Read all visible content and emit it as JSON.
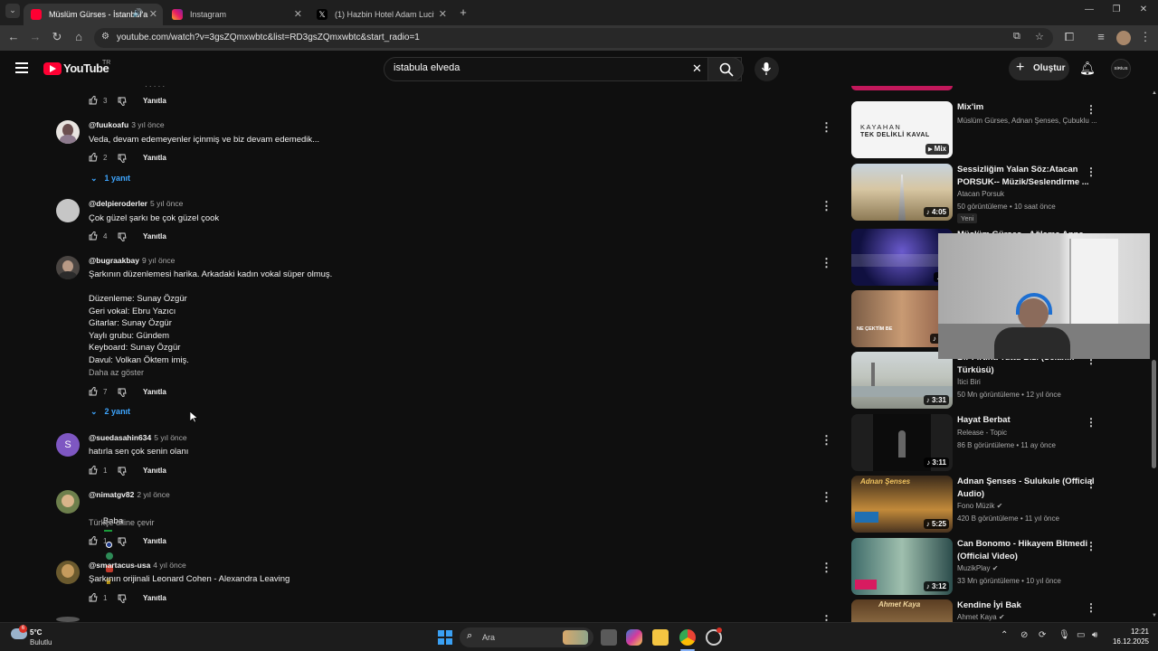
{
  "browser": {
    "tabs": [
      {
        "title": "Müslüm Gürses - İstanbul'a",
        "active": true
      },
      {
        "title": "Instagram",
        "active": false
      },
      {
        "title": "(1) Hazbin Hotel Adam Lucifer",
        "active": false
      }
    ],
    "url": "youtube.com/watch?v=3gsZQmxwbtc&list=RD3gsZQmxwbtc&start_radio=1"
  },
  "youtube": {
    "logo_text": "YouTube",
    "country": "TR",
    "search_value": "istabula elveda",
    "create_label": "Oluştur",
    "avatar_text": "SİRİUS"
  },
  "comments": [
    {
      "likes": "3",
      "reply_label": "Yanıtla"
    },
    {
      "user": "@fuukoafu",
      "time": "3 yıl önce",
      "text": "Veda, devam edemeyenler içinmiş ve biz devam edemedik...",
      "likes": "2",
      "reply_label": "Yanıtla",
      "replies": "1 yanıt"
    },
    {
      "user": "@delpieroderler",
      "time": "5 yıl önce",
      "text": "Çok güzel şarkı be çok güzel çook",
      "likes": "4",
      "reply_label": "Yanıtla"
    },
    {
      "user": "@bugraakbay",
      "time": "9 yıl önce",
      "text": "Şarkının düzenlemesi harika. Arkadaki kadın vokal süper olmuş.\n\nDüzenleme: Sunay Özgür\nGeri vokal: Ebru Yazıcı\nGitarlar: Sunay Özgür\nYaylı grubu: Gündem\nKeyboard: Sunay Özgür\nDavul: Volkan Öktem imiş.",
      "less_label": "Daha az göster",
      "likes": "7",
      "reply_label": "Yanıtla",
      "replies": "2 yanıt"
    },
    {
      "user": "@suedasahin634",
      "time": "5 yıl önce",
      "avatar_letter": "S",
      "text": "hatırla sen çok senin olanı",
      "likes": "1",
      "reply_label": "Yanıtla"
    },
    {
      "user": "@nimatgv82",
      "time": "2 yıl önce",
      "text": "Baba",
      "translate_label": "Türkçe diline çevir",
      "likes": "1",
      "reply_label": "Yanıtla"
    },
    {
      "user": "@smartacus-usa",
      "time": "4 yıl önce",
      "text": "Şarkının orijinali Leonard Cohen - Alexandra Leaving",
      "likes": "1",
      "reply_label": "Yanıtla"
    }
  ],
  "sidebar": [
    {
      "title": "Mix'im",
      "sub1": "Müslüm Gürses, Adnan Şenses, Çubuklu ...",
      "thumb_text_1": "KAYAHAN",
      "thumb_text_2": "TEK DELİKLİ KAVAL",
      "duration": "Mix"
    },
    {
      "title": "Sessizliğim Yalan Söz:Atacan PORSUK-- Müzik/Seslendirme ...",
      "sub1": "Atacan Porsuk",
      "sub2": "50 görüntüleme • 10 saat önce",
      "badge": "Yeni",
      "duration": "4:05"
    },
    {
      "title": "Müslüm Gürses - Ağlama Anne",
      "duration": "3"
    },
    {
      "duration": "20",
      "thumb_caption": "NE ÇEKTİM BE"
    },
    {
      "title": "Bir Fırtına Tuttu Bizi (Selanik Türküsü)",
      "sub1": "İtici Biri",
      "sub2": "50 Mn görüntüleme • 12 yıl önce",
      "duration": "3:31"
    },
    {
      "title": "Hayat Berbat",
      "sub1": "Release - Topic",
      "sub2": "86 B görüntüleme • 11 ay önce",
      "duration": "3:11"
    },
    {
      "title": "Adnan Şenses - Sulukule (Official Audio)",
      "sub1": "Fono Müzik",
      "sub2": "420 B görüntüleme • 11 yıl önce",
      "duration": "5:25",
      "thumb_caption": "Adnan Şenses"
    },
    {
      "title": "Can Bonomo - Hikayem Bitmedi (Official Video)",
      "sub1": "MuzikPlay",
      "sub2": "33 Mn görüntüleme • 10 yıl önce",
      "duration": "3:12"
    },
    {
      "title": "Kendine İyi Bak",
      "sub1": "Ahmet Kaya",
      "thumb_caption": "Ahmet Kaya"
    }
  ],
  "taskbar": {
    "weather_temp": "5°C",
    "weather_desc": "Bulutlu",
    "search_label": "Ara",
    "time": "12:21",
    "date": "16.12.2025"
  }
}
